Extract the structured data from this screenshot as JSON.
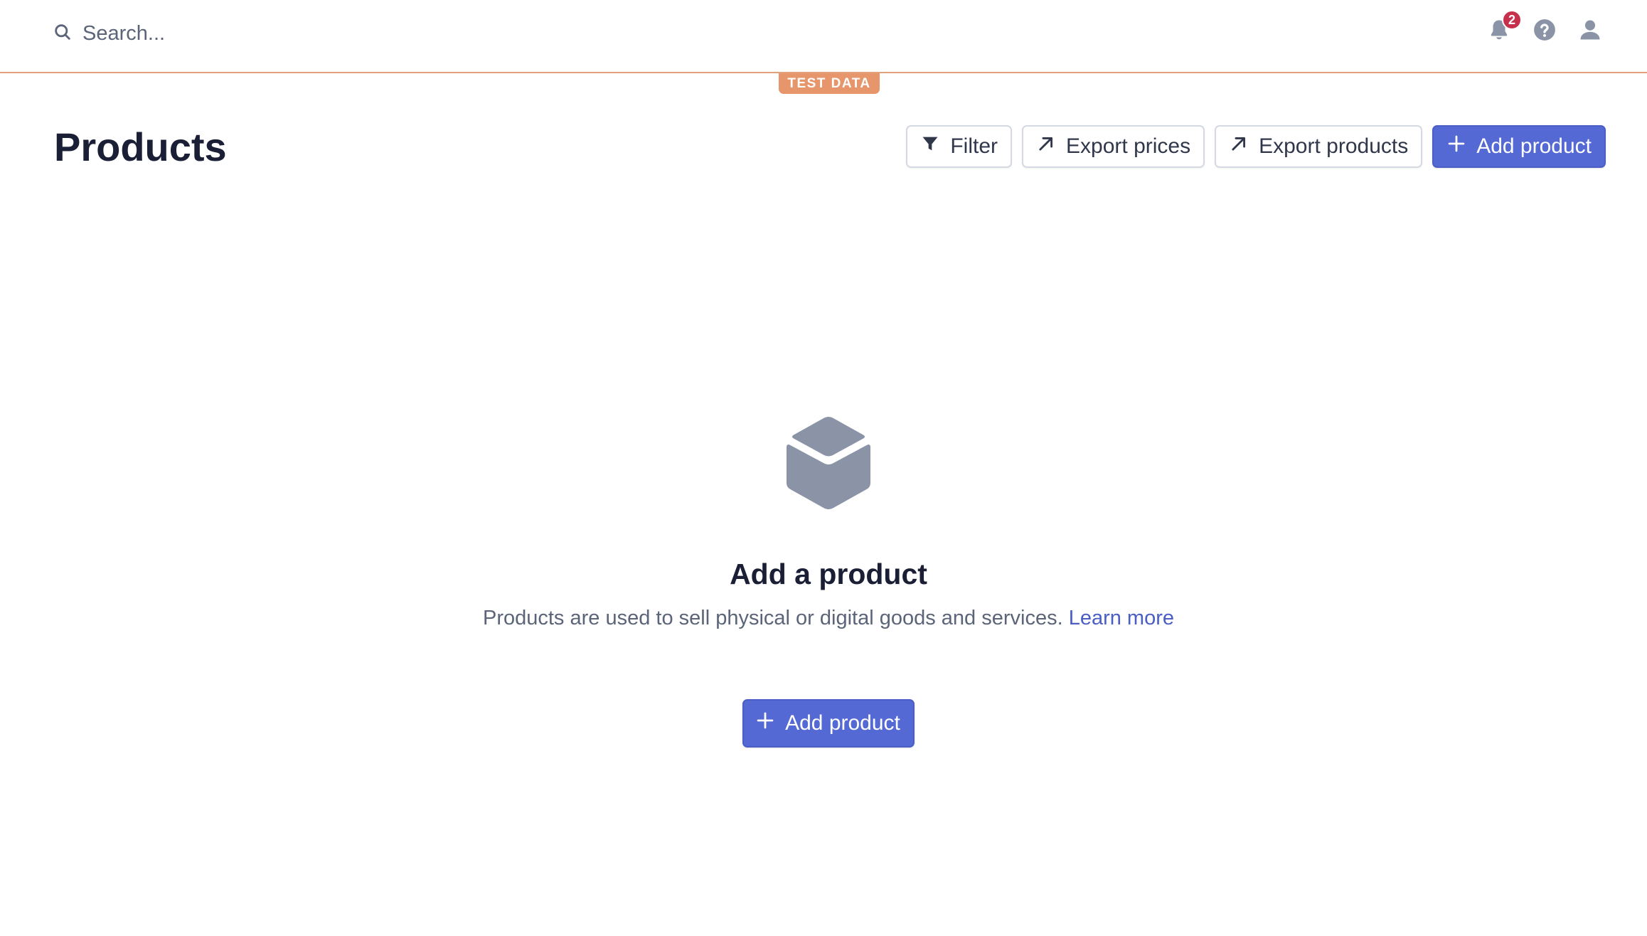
{
  "search": {
    "placeholder": "Search..."
  },
  "header_icons": {
    "notifications_count": "2"
  },
  "test_data_label": "TEST DATA",
  "page": {
    "title": "Products"
  },
  "actions": {
    "filter_label": "Filter",
    "export_prices_label": "Export prices",
    "export_products_label": "Export products",
    "add_product_label": "Add product"
  },
  "empty_state": {
    "title": "Add a product",
    "description": "Products are used to sell physical or digital goods and services.",
    "learn_more_label": "Learn more",
    "cta_label": "Add product"
  },
  "icons": {
    "search": "search-icon",
    "notifications": "bell-icon",
    "help": "help-icon",
    "account": "user-icon",
    "filter": "filter-icon",
    "export": "arrow-up-right-icon",
    "add": "plus-icon",
    "empty_state": "box-icon"
  },
  "colors": {
    "primary": "#5469d4",
    "test_data": "#e7956b",
    "badge": "#c6304d",
    "icon_gray": "#8a94a6"
  }
}
